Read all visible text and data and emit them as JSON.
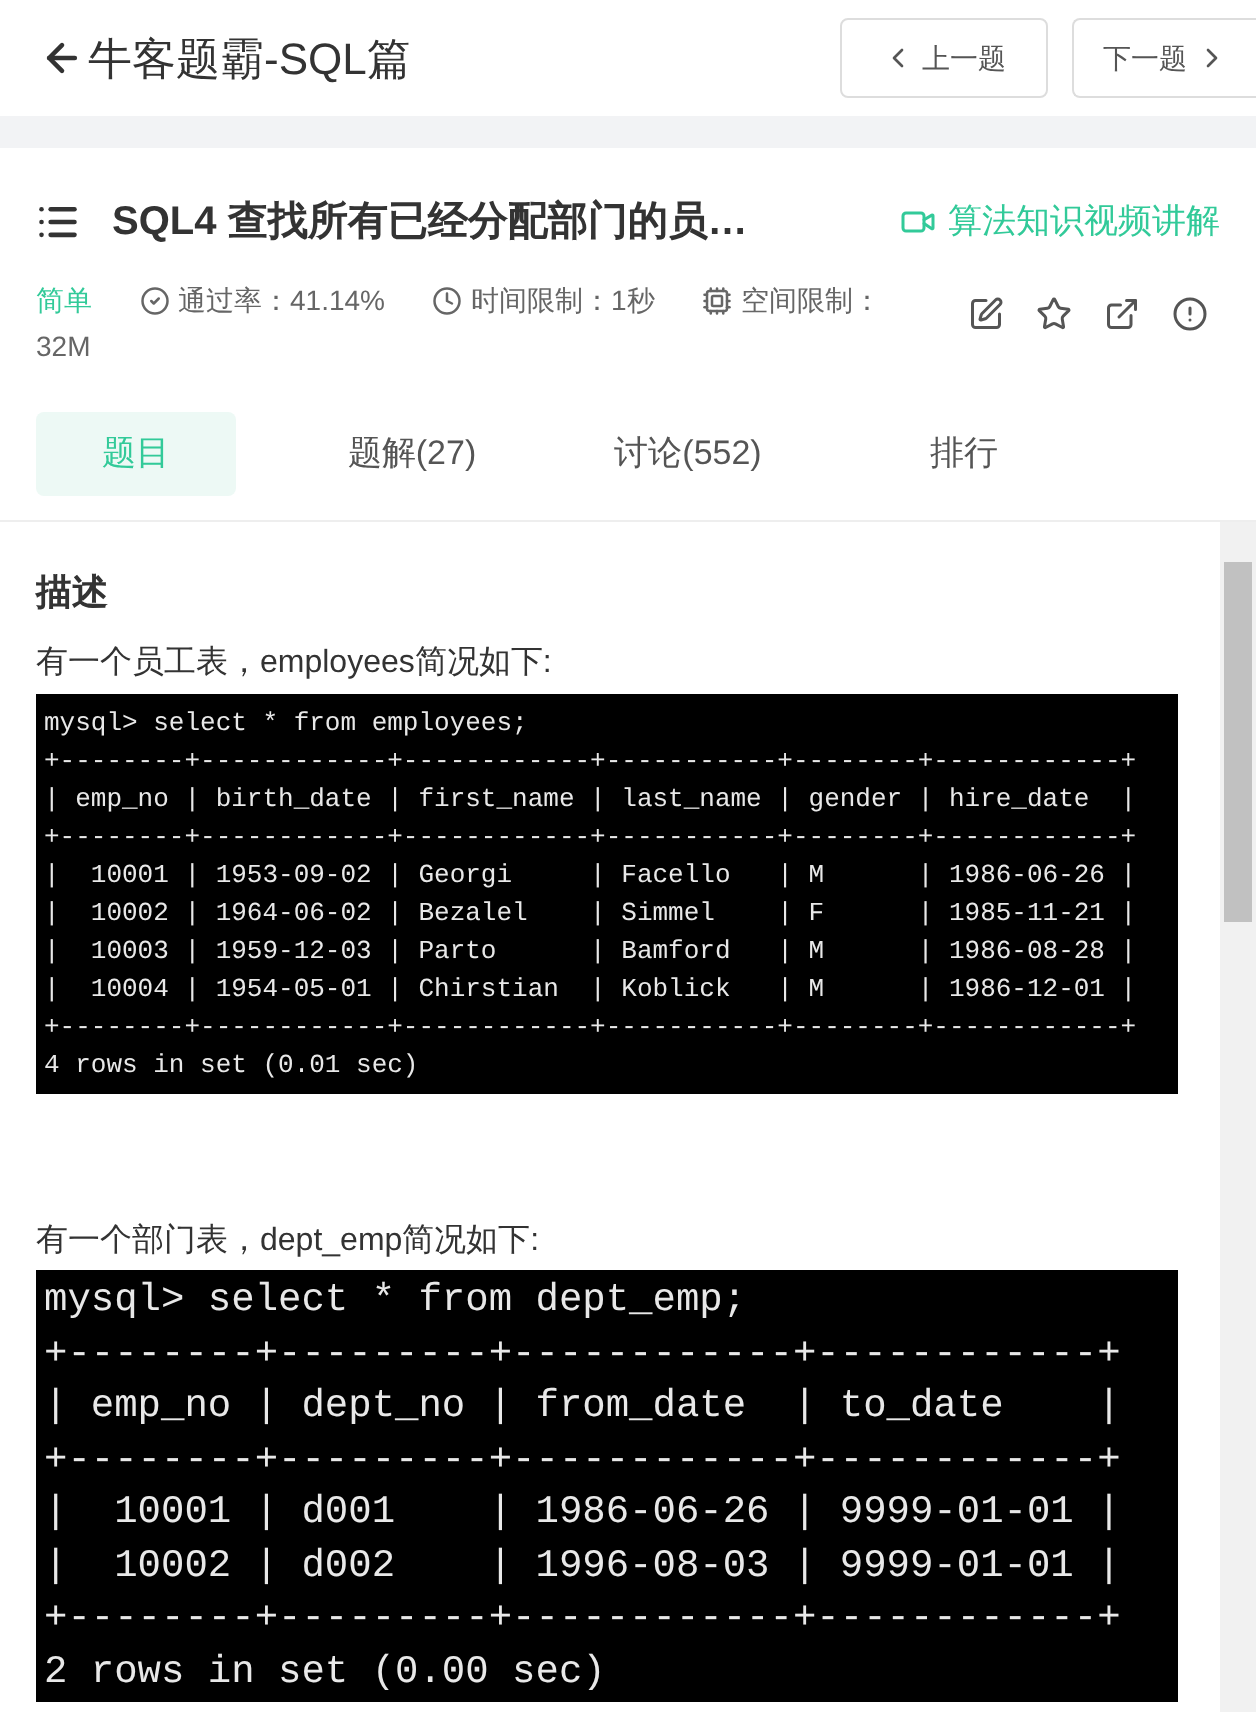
{
  "header": {
    "title": "牛客题霸-SQL篇",
    "prev_button": "上一题",
    "next_button": "下一题"
  },
  "problem": {
    "title": "SQL4  查找所有已经分配部门的员…",
    "video_link": "算法知识视频讲解",
    "difficulty": "简单",
    "pass_rate": "通过率：41.14%",
    "time_limit": "时间限制：1秒",
    "space_limit_label": "空间限制：",
    "space_limit_value": "32M"
  },
  "tabs": [
    {
      "label": "题目",
      "selected": true
    },
    {
      "label": "题解(27)",
      "selected": false
    },
    {
      "label": "讨论(552)",
      "selected": false
    },
    {
      "label": "排行",
      "selected": false
    }
  ],
  "description": {
    "heading": "描述",
    "blocks": [
      {
        "caption": "有一个员工表，employees简况如下:",
        "kind": "small",
        "lines": [
          "mysql> select * from employees;",
          "+--------+------------+------------+-----------+--------+------------+",
          "| emp_no | birth_date | first_name | last_name | gender | hire_date  |",
          "+--------+------------+------------+-----------+--------+------------+",
          "|  10001 | 1953-09-02 | Georgi     | Facello   | M      | 1986-06-26 |",
          "|  10002 | 1964-06-02 | Bezalel    | Simmel    | F      | 1985-11-21 |",
          "|  10003 | 1959-12-03 | Parto      | Bamford   | M      | 1986-08-28 |",
          "|  10004 | 1954-05-01 | Chirstian  | Koblick   | M      | 1986-12-01 |",
          "+--------+------------+------------+-----------+--------+------------+",
          "4 rows in set (0.01 sec)"
        ]
      },
      {
        "caption": "有一个部门表，dept_emp简况如下:",
        "kind": "large",
        "lines": [
          "mysql> select * from dept_emp;",
          "+--------+---------+------------+------------+",
          "| emp_no | dept_no | from_date  | to_date    |",
          "+--------+---------+------------+------------+",
          "|  10001 | d001    | 1986-06-26 | 9999-01-01 |",
          "|  10002 | d002    | 1996-08-03 | 9999-01-01 |",
          "+--------+---------+------------+------------+",
          "2 rows in set (0.00 sec)"
        ]
      }
    ]
  }
}
